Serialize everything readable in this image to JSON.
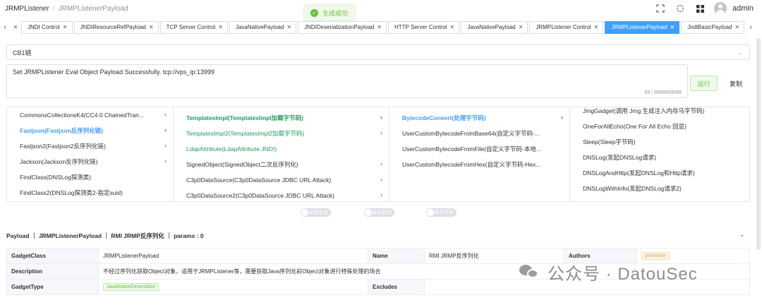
{
  "header": {
    "breadcrumb": [
      "JRMPListener",
      "/",
      "JRMPListenerPayload"
    ],
    "user": "admin"
  },
  "toast": {
    "text": "生成成功"
  },
  "tabs": [
    {
      "label": "JNDI Control"
    },
    {
      "label": "JNDIResourceRefPayload"
    },
    {
      "label": "TCP Server Control"
    },
    {
      "label": "JavaNativePayload"
    },
    {
      "label": "JNDIDeserializationPayload"
    },
    {
      "label": "HTTP Server Control"
    },
    {
      "label": "JavaNativePayload"
    },
    {
      "label": "JRMPListener Control"
    },
    {
      "label": "JRMPListenerPayload",
      "active": true
    },
    {
      "label": "JndiBasicPayload"
    }
  ],
  "chain_select": {
    "value": "CB1链"
  },
  "output": {
    "text": "Set JRMPListener Eval Object Payload Successfully. tcp://vps_ip:13999",
    "counter": "69 / 9999999999"
  },
  "buttons": {
    "run": "运行",
    "copy": "复制"
  },
  "cascader": {
    "col1": [
      "CommonsCollectionsK4(CC4.0 ChainedTran...",
      "Fastjson(Fastjson反序列化链)",
      "Fastjson2(Fastjson2反序列化链)",
      "Jackson(Jackson反序列化链)",
      "FindClass(DNSLog探测类)",
      "FindClass2(DNSLog探测类2-指定suid)"
    ],
    "col2": [
      "TemplatesImpl(TemplatesImpl加载字节码)",
      "TemplatesImpl2(TemplatesImpl2加载字节码)",
      "LdapAttribute(LdapAttribute JNDI)",
      "SignedObject(SignedObject二次反序列化)",
      "C3p0DataSource(C3p0DataSource JDBC URL Attack)",
      "C3p0DataSource2(C3p0DataSource JDBC URL Attack)"
    ],
    "col3": [
      "BytecodeConvert(处理字节码)",
      "UserCustomBytecodeFromBase64(自定义字节码-...",
      "UserCustomBytecodeFromFile(自定义字节码-本地...",
      "UserCustomBytecodeFromHex(自定义字节码-Hex..."
    ],
    "col4": [
      "JmgGadget(调用 Jmg 生成注入内存马字节码)",
      "OneForAllEcho(One For All Echo 回显)",
      "Sleep(Sleep字节码)",
      "DNSLog(发起DNSLog请求)",
      "DNSLogAndHttp(发起DNSLog和Http请求)",
      "DNSLogWithInfo(发起DNSLog请求2)"
    ]
  },
  "switches": [
    "自动生成",
    "自动复制",
    "展开所有"
  ],
  "detail": {
    "header": "Payload ｜ JRMPListenerPayload ｜ RMI JRMP反序列化 ｜ params : 0",
    "gadget_class_label": "GadgetClass",
    "gadget_class": "JRMPListenerPayload",
    "name_label": "Name",
    "name": "RMI JRMP反序列化",
    "authors_label": "Authors",
    "authors": "pwntester",
    "description_label": "Description",
    "description": "不经过序列化获取Object对象，适用于JRMPListener等，需要获取Java序列化前Object对象进行特殊处理的场合",
    "gadget_type_label": "GadgetType",
    "gadget_type": "JavaNativeDeserialize",
    "excludes_label": "Excludes"
  },
  "watermark": "公众号 · DatouSec",
  "colors": {
    "primary": "#409eff",
    "success": "#67c23a",
    "warning": "#e6a23c"
  }
}
